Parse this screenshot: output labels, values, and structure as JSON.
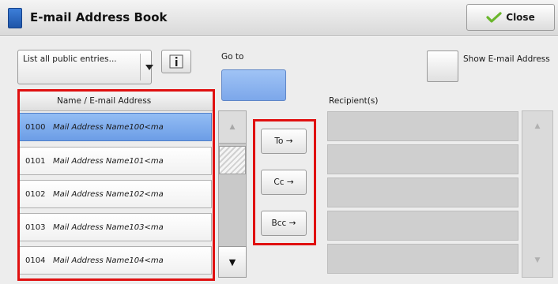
{
  "header": {
    "title": "E-mail Address Book",
    "close_label": "Close"
  },
  "toolbar": {
    "filter_value": "List all public entries...",
    "goto_label": "Go to",
    "show_email_label": "Show E-mail Address"
  },
  "list": {
    "column_header": "Name / E-mail Address",
    "rows": [
      {
        "num": "0100",
        "name": "Mail Address Name100<ma",
        "selected": true
      },
      {
        "num": "0101",
        "name": "Mail Address Name101<ma",
        "selected": false
      },
      {
        "num": "0102",
        "name": "Mail Address Name102<ma",
        "selected": false
      },
      {
        "num": "0103",
        "name": "Mail Address Name103<ma",
        "selected": false
      },
      {
        "num": "0104",
        "name": "Mail Address Name104<ma",
        "selected": false
      }
    ]
  },
  "buttons": {
    "to_label": "To →",
    "cc_label": "Cc →",
    "bcc_label": "Bcc →"
  },
  "recipients": {
    "label": "Recipient(s)"
  },
  "colors": {
    "selected_row": "#7ca7ea",
    "highlight": "#e01010"
  }
}
